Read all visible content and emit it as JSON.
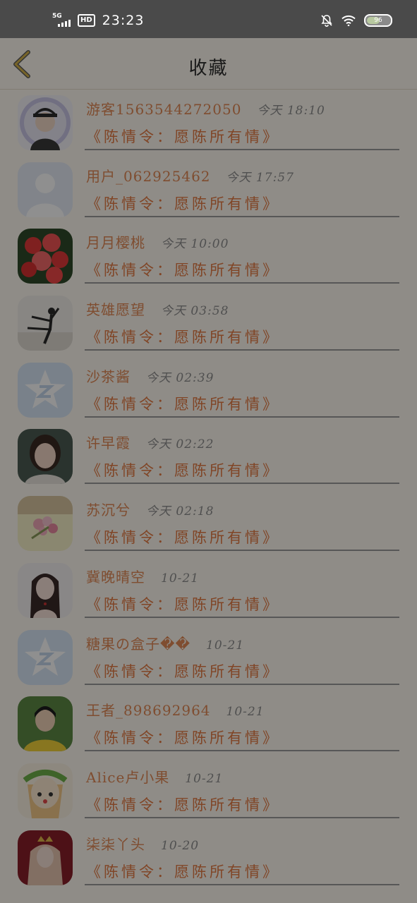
{
  "status_bar": {
    "network": "5G",
    "hd_badge": "HD",
    "time": "23:23",
    "battery": "96"
  },
  "header": {
    "title": "收藏"
  },
  "colors": {
    "name": "#e28a57",
    "title": "#e57c45",
    "time": "#8f8f8f",
    "background": "#fffaf0"
  },
  "favorites": [
    {
      "name": "游客1563544272050",
      "time": "今天 18:10",
      "title": "《陈情令：愿陈所有情》",
      "avatar": "cartoon-avatar"
    },
    {
      "name": "用户_062925462",
      "time": "今天 17:57",
      "title": "《陈情令：愿陈所有情》",
      "avatar": "default-user-avatar"
    },
    {
      "name": "月月樱桃",
      "time": "今天 10:00",
      "title": "《陈情令：愿陈所有情》",
      "avatar": "flower-avatar"
    },
    {
      "name": "英雄愿望",
      "time": "今天 03:58",
      "title": "《陈情令：愿陈所有情》",
      "avatar": "dancer-avatar"
    },
    {
      "name": "沙茶酱",
      "time": "今天 02:39",
      "title": "《陈情令：愿陈所有情》",
      "avatar": "qzone-avatar"
    },
    {
      "name": "许早霞",
      "time": "今天 02:22",
      "title": "《陈情令：愿陈所有情》",
      "avatar": "portrait-avatar"
    },
    {
      "name": "苏沉兮",
      "time": "今天 02:18",
      "title": "《陈情令：愿陈所有情》",
      "avatar": "bouquet-avatar"
    },
    {
      "name": "冀晚晴空",
      "time": "10-21",
      "title": "《陈情令：愿陈所有情》",
      "avatar": "girl-avatar"
    },
    {
      "name": "糖果の盒子��",
      "time": "10-21",
      "title": "《陈情令：愿陈所有情》",
      "avatar": "qzone-avatar"
    },
    {
      "name": "王者_898692964",
      "time": "10-21",
      "title": "《陈情令：愿陈所有情》",
      "avatar": "boy-avatar"
    },
    {
      "name": "Alice卢小果",
      "time": "10-21",
      "title": "《陈情令：愿陈所有情》",
      "avatar": "wreath-cartoon-avatar"
    },
    {
      "name": "柒柒丫头",
      "time": "10-20",
      "title": "《陈情令：愿陈所有情》",
      "avatar": "crown-girl-avatar"
    }
  ]
}
